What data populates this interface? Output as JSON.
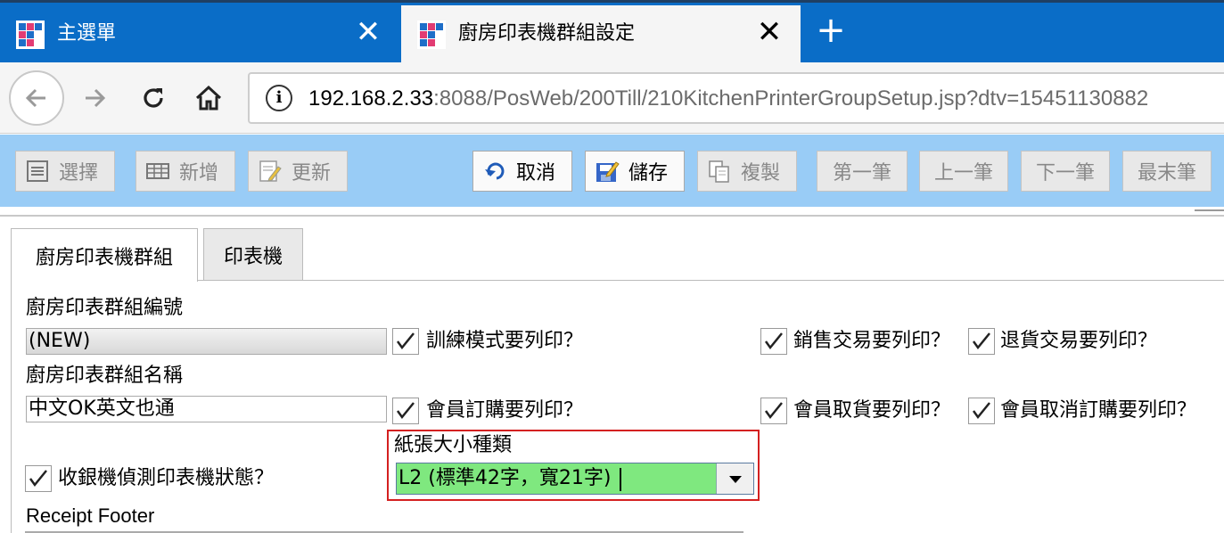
{
  "browser": {
    "tabs": [
      {
        "title": "主選單",
        "active": false
      },
      {
        "title": "廚房印表機群組設定",
        "active": true
      }
    ],
    "close_glyph": "✕",
    "new_tab_glyph": "+",
    "address": {
      "host": "192.168.2.33",
      "rest": ":8088/PosWeb/200Till/210KitchenPrinterGroupSetup.jsp?dtv=15451130882"
    },
    "icons": {
      "back": "back-arrow-icon",
      "forward": "forward-arrow-icon",
      "reload": "reload-icon",
      "home": "home-icon",
      "info": "info-icon"
    }
  },
  "toolbar": {
    "select": "選擇",
    "add": "新增",
    "update": "更新",
    "cancel": "取消",
    "save": "儲存",
    "copy": "複製",
    "first": "第一筆",
    "prev": "上一筆",
    "next": "下一筆",
    "last": "最末筆",
    "colors": {
      "bar": "#99ccf6",
      "disabled_text": "#888888"
    }
  },
  "page_tabs": [
    {
      "label": "廚房印表機群組",
      "active": true
    },
    {
      "label": "印表機",
      "active": false
    }
  ],
  "form": {
    "group_no_label": "廚房印表群組編號",
    "group_no_value": "(NEW)",
    "group_name_label": "廚房印表群組名稱",
    "group_name_value": "中文OK英文也通",
    "checkboxes": {
      "training": {
        "label": "訓練模式要列印？",
        "checked": true
      },
      "sales": {
        "label": "銷售交易要列印？",
        "checked": true
      },
      "refund": {
        "label": "退貨交易要列印？",
        "checked": true
      },
      "member_order": {
        "label": "會員訂購要列印？",
        "checked": true
      },
      "member_pickup": {
        "label": "會員取貨要列印？",
        "checked": true
      },
      "member_cancel": {
        "label": "會員取消訂購要列印？",
        "checked": true
      },
      "detect_status": {
        "label": "收銀機偵測印表機狀態？",
        "checked": true
      }
    },
    "paper_size_label": "紙張大小種類",
    "paper_size_value": "L2 (標準42字，寬21字)",
    "receipt_footer_label": "Receipt Footer",
    "highlight_color": "#d42020",
    "select_color": "#7fe87f"
  }
}
